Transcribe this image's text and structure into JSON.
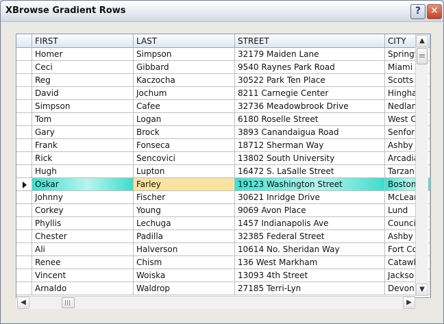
{
  "window": {
    "title": "XBrowse Gradient Rows",
    "help_icon": "?",
    "close_icon": "✕"
  },
  "grid": {
    "columns": [
      "FIRST",
      "LAST",
      "STREET",
      "CITY"
    ],
    "selected_row_index": 10,
    "rows": [
      [
        "Homer",
        "Simpson",
        "32179 Maiden Lane",
        "Springf"
      ],
      [
        "Ceci",
        "Gibbard",
        "9540 Raynes Park Road",
        "Miami"
      ],
      [
        "Reg",
        "Kaczocha",
        "30522 Park Ten Place",
        "Scotts"
      ],
      [
        "David",
        "Jochum",
        "8211 Carnegie Center",
        "Hingha"
      ],
      [
        "Simpson",
        "Cafee",
        "32736 Meadowbrook Drive",
        "Nedlan"
      ],
      [
        "Tom",
        "Logan",
        "6180 Roselle Street",
        "West C"
      ],
      [
        "Gary",
        "Brock",
        "3893 Canandaigua Road",
        "Senfor"
      ],
      [
        "Frank",
        "Fonseca",
        "18712 Sherman Way",
        "Ashby"
      ],
      [
        "Rick",
        "Sencovici",
        "13802 South University",
        "Arcadia"
      ],
      [
        "Hugh",
        "Lupton",
        "16472 S. LaSalle Street",
        "Tarzan"
      ],
      [
        "Oskar",
        "Farley",
        "19123 Washington Street",
        "Boston"
      ],
      [
        "Johnny",
        "Fischer",
        "30621 Inridge Drive",
        "McLean"
      ],
      [
        "Corkey",
        "Young",
        "9069 Avon Place",
        "Lund"
      ],
      [
        "Phyllis",
        "Lechuga",
        "1457 Indianapolis Ave",
        "Counci"
      ],
      [
        "Chester",
        "Padilla",
        "32385 Federal Street",
        "Ashby"
      ],
      [
        "Ali",
        "Halverson",
        "10614 No. Sheridan Way",
        "Fort Co"
      ],
      [
        "Renee",
        "Chism",
        "136 West Markham",
        "Catawb"
      ],
      [
        "Vincent",
        "Woiska",
        "13093 4th Street",
        "Jackso"
      ],
      [
        "Arnaldo",
        "Waldrop",
        "27185 Terri-Lyn",
        "Devon"
      ]
    ]
  },
  "scrollbars": {
    "up_icon": "▲",
    "down_icon": "▼",
    "left_icon": "◀",
    "right_icon": "▶"
  }
}
